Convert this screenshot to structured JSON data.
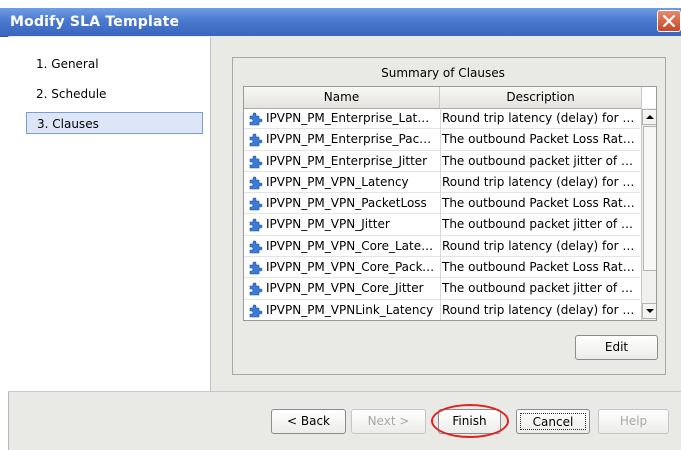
{
  "window": {
    "title": "Modify SLA Template"
  },
  "steps": [
    {
      "label": "1. General",
      "active": false
    },
    {
      "label": "2. Schedule",
      "active": false
    },
    {
      "label": "3. Clauses",
      "active": true
    }
  ],
  "summary": {
    "title": "Summary of Clauses",
    "columns": [
      "Name",
      "Description"
    ],
    "rows": [
      {
        "name": "IPVPN_PM_Enterprise_Latency",
        "description": "Round trip latency (delay) for a ..."
      },
      {
        "name": "IPVPN_PM_Enterprise_Packe...",
        "description": "The outbound Packet Loss Ratio ..."
      },
      {
        "name": "IPVPN_PM_Enterprise_Jitter",
        "description": "The outbound packet jitter of VP..."
      },
      {
        "name": "IPVPN_PM_VPN_Latency",
        "description": "Round trip latency (delay) for a s..."
      },
      {
        "name": "IPVPN_PM_VPN_PacketLoss",
        "description": "The outbound Packet Loss Ratio ..."
      },
      {
        "name": "IPVPN_PM_VPN_Jitter",
        "description": "The outbound packet jitter of VP..."
      },
      {
        "name": "IPVPN_PM_VPN_Core_Latency",
        "description": "Round trip latency (delay) for a s..."
      },
      {
        "name": "IPVPN_PM_VPN_Core_Packet...",
        "description": "The outbound Packet Loss Ratio ..."
      },
      {
        "name": "IPVPN_PM_VPN_Core_Jitter",
        "description": "The outbound packet jitter of VP..."
      },
      {
        "name": "IPVPN_PM_VPNLink_Latency",
        "description": "Round trip latency (delay) for a s..."
      }
    ],
    "row_icon": "puzzle-piece-icon",
    "edit_label": "Edit"
  },
  "footer": {
    "back_label": "< Back",
    "next_label": "Next >",
    "finish_label": "Finish",
    "cancel_label": "Cancel",
    "help_label": "Help"
  },
  "colors": {
    "titlebar": "#4a79cf",
    "highlight": "#e02222",
    "icon": "#3a7bd5"
  }
}
